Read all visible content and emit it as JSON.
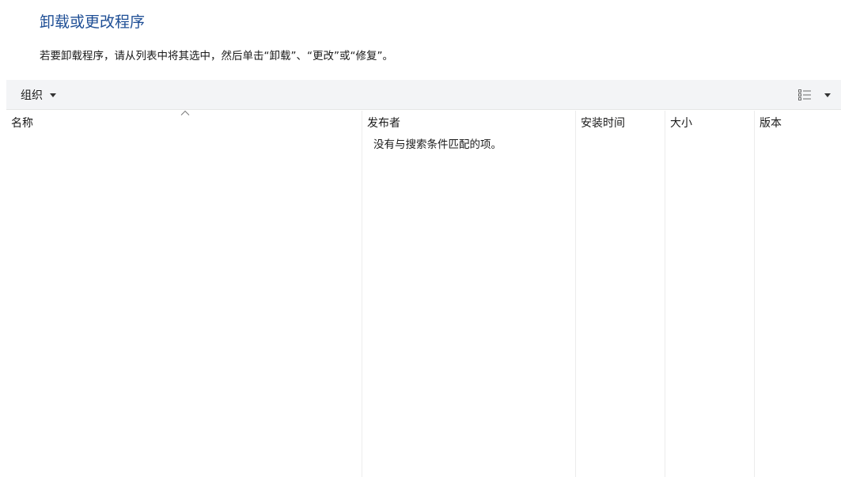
{
  "header": {
    "title": "卸载或更改程序",
    "description": "若要卸载程序，请从列表中将其选中，然后单击“卸载”、“更改”或“修复”。"
  },
  "toolbar": {
    "organize_label": "组织",
    "view_icon": "details-view-icon",
    "dropdown_icon": "chevron-down-icon"
  },
  "list": {
    "columns": [
      {
        "label": "名称"
      },
      {
        "label": "发布者"
      },
      {
        "label": "安装时间"
      },
      {
        "label": "大小"
      },
      {
        "label": "版本"
      }
    ],
    "sort_icon": "sort-ascending-icon",
    "empty_message": "没有与搜索条件匹配的项。"
  },
  "colors": {
    "title": "#1e4e95",
    "toolbar_bg": "#f3f4f6",
    "divider": "#ececec"
  }
}
